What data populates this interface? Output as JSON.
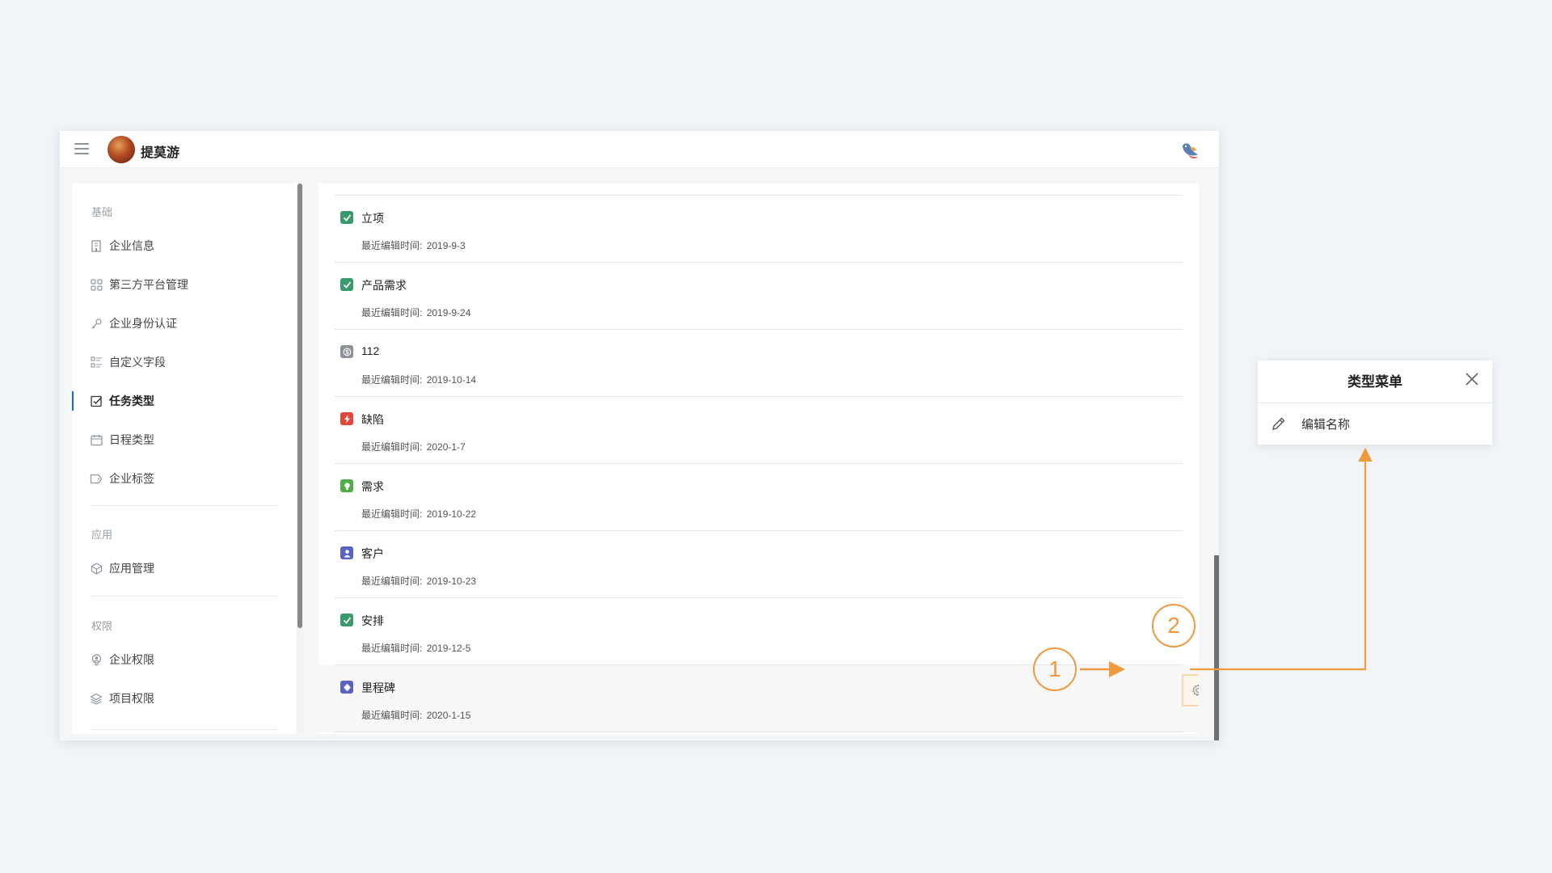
{
  "topbar": {
    "org_name": "提莫游",
    "menu_icon": "hamburger-icon",
    "right_icon": "bird-logo-icon"
  },
  "sidebar": {
    "sections": [
      {
        "title": "基础",
        "items": [
          {
            "label": "企业信息",
            "icon": "building-icon",
            "active": false
          },
          {
            "label": "第三方平台管理",
            "icon": "apps-grid-icon",
            "active": false
          },
          {
            "label": "企业身份认证",
            "icon": "key-icon",
            "active": false
          },
          {
            "label": "自定义字段",
            "icon": "fields-list-icon",
            "active": false
          },
          {
            "label": "任务类型",
            "icon": "checkbox-icon",
            "active": true
          },
          {
            "label": "日程类型",
            "icon": "calendar-icon",
            "active": false
          },
          {
            "label": "企业标签",
            "icon": "tag-icon",
            "active": false
          }
        ]
      },
      {
        "title": "应用",
        "items": [
          {
            "label": "应用管理",
            "icon": "cube-icon",
            "active": false
          }
        ]
      },
      {
        "title": "权限",
        "items": [
          {
            "label": "企业权限",
            "icon": "user-shield-icon",
            "active": false
          },
          {
            "label": "项目权限",
            "icon": "layers-icon",
            "active": false
          }
        ]
      }
    ]
  },
  "task_types": {
    "meta_label": "最近编辑时间:",
    "items": [
      {
        "name": "立项",
        "date": "2019-9-3",
        "icon": "check-square-icon",
        "color": "#3a9a6e"
      },
      {
        "name": "产品需求",
        "date": "2019-9-24",
        "icon": "check-square-icon",
        "color": "#3a9a6e"
      },
      {
        "name": "112",
        "date": "2019-10-14",
        "icon": "dollar-circle-icon",
        "color": "#8d929a"
      },
      {
        "name": "缺陷",
        "date": "2020-1-7",
        "icon": "bolt-icon",
        "color": "#e0483e"
      },
      {
        "name": "需求",
        "date": "2019-10-22",
        "icon": "bulb-icon",
        "color": "#4fae48"
      },
      {
        "name": "客户",
        "date": "2019-10-23",
        "icon": "person-icon",
        "color": "#5b62c2"
      },
      {
        "name": "安排",
        "date": "2019-12-5",
        "icon": "check-square-icon",
        "color": "#3a9a6e"
      },
      {
        "name": "里程碑",
        "date": "2020-1-15",
        "icon": "diamond-icon",
        "color": "#5b62c2"
      }
    ]
  },
  "row_actions": {
    "settings_icon": "gear-icon",
    "more_icon": "more-horizontal-icon"
  },
  "popover": {
    "title": "类型菜单",
    "close_icon": "close-icon",
    "items": [
      {
        "label": "编辑名称",
        "icon": "pencil-icon"
      }
    ]
  },
  "annotations": {
    "callout_1": "1",
    "callout_2": "2",
    "color": "#ee9a3e"
  }
}
